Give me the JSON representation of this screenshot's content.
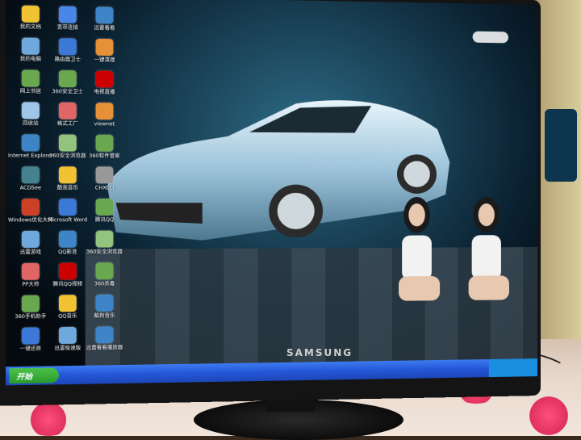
{
  "monitor": {
    "brand": "SAMSUNG"
  },
  "taskbar": {
    "start_label": "开始"
  },
  "desktop_icons": [
    {
      "label": "我的文档",
      "color": "#f1c232"
    },
    {
      "label": "宽带连接",
      "color": "#4a86e8"
    },
    {
      "label": "迅雷看看",
      "color": "#3d85c6"
    },
    {
      "label": "我的电脑",
      "color": "#6fa8dc"
    },
    {
      "label": "路由器卫士",
      "color": "#3c78d8"
    },
    {
      "label": "一键清理",
      "color": "#e69138"
    },
    {
      "label": "网上邻居",
      "color": "#6aa84f"
    },
    {
      "label": "360安全卫士",
      "color": "#6aa84f"
    },
    {
      "label": "电视直播",
      "color": "#cc0000"
    },
    {
      "label": "回收站",
      "color": "#9fc5e8"
    },
    {
      "label": "格式工厂",
      "color": "#e06666"
    },
    {
      "label": "viewnet",
      "color": "#e69138"
    },
    {
      "label": "Internet Explorer",
      "color": "#3d85c6"
    },
    {
      "label": "360安全浏览器",
      "color": "#93c47d"
    },
    {
      "label": "360软件管家",
      "color": "#6aa84f"
    },
    {
      "label": "ACDSee",
      "color": "#45818e"
    },
    {
      "label": "酷我音乐",
      "color": "#f1c232"
    },
    {
      "label": "CHXCLI",
      "color": "#999999"
    },
    {
      "label": "Windows优化大师",
      "color": "#cc4125"
    },
    {
      "label": "Microsoft Word",
      "color": "#3c78d8"
    },
    {
      "label": "腾讯QQ",
      "color": "#6aa84f"
    },
    {
      "label": "迅雷游戏",
      "color": "#6fa8dc"
    },
    {
      "label": "QQ影音",
      "color": "#3d85c6"
    },
    {
      "label": "360安全浏览器",
      "color": "#93c47d"
    },
    {
      "label": "PP大师",
      "color": "#e06666"
    },
    {
      "label": "腾讯QQ视频",
      "color": "#cc0000"
    },
    {
      "label": "360杀毒",
      "color": "#6aa84f"
    },
    {
      "label": "360手机助手",
      "color": "#6aa84f"
    },
    {
      "label": "QQ音乐",
      "color": "#f1c232"
    },
    {
      "label": "酷狗音乐",
      "color": "#3d85c6"
    },
    {
      "label": "一键还原",
      "color": "#3c78d8"
    },
    {
      "label": "迅雷极速版",
      "color": "#6fa8dc"
    },
    {
      "label": "迅雷看看播放器",
      "color": "#3d85c6"
    }
  ],
  "colors": {
    "taskbar": "#2457d8",
    "start": "#2a9a2a",
    "car": "#b8d4e6"
  }
}
